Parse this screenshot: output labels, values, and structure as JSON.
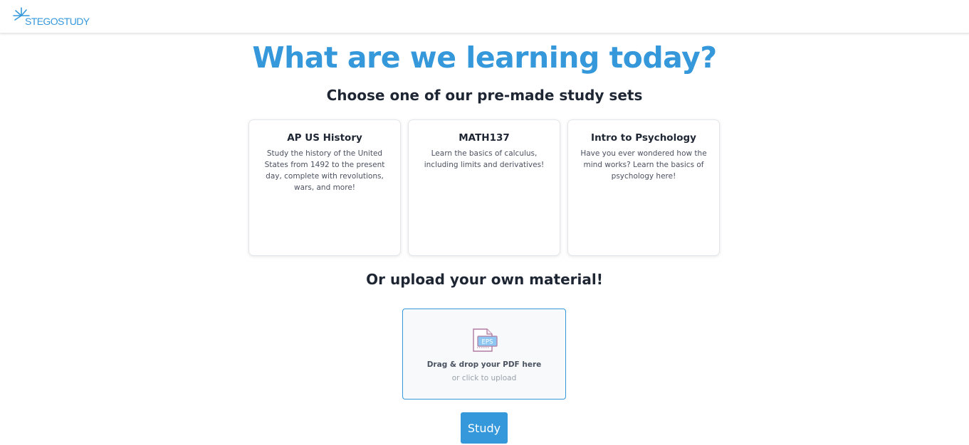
{
  "brand": {
    "logo_text": "STEGOSTUDY",
    "accent_color": "#3598db",
    "logo_icon": "sunburst-logo-icon"
  },
  "hero": {
    "title": "What are we learning today?"
  },
  "premade": {
    "heading": "Choose one of our pre-made study sets",
    "cards": [
      {
        "title": "AP US History",
        "description": "Study the history of the United States from 1492 to the present day, complete with revolutions, wars, and more!"
      },
      {
        "title": "MATH137",
        "description": "Learn the basics of calculus, including limits and derivatives!"
      },
      {
        "title": "Intro to Psychology",
        "description": "Have you ever wondered how the mind works? Learn the basics of psychology here!"
      }
    ]
  },
  "upload": {
    "heading": "Or upload your own material!",
    "icon": "eps-file-icon",
    "icon_label": "EPS",
    "primary_text": "Drag & drop your PDF here",
    "secondary_text": "or click to upload"
  },
  "actions": {
    "study_label": "Study"
  }
}
